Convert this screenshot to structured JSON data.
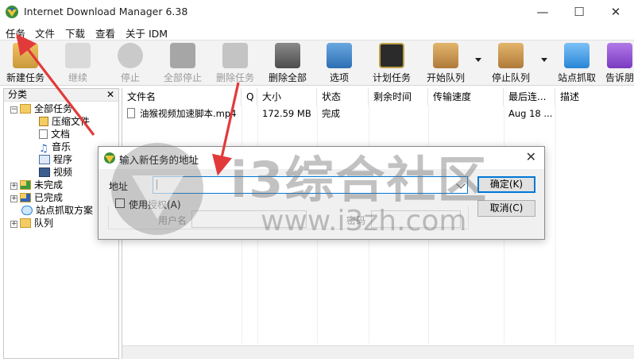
{
  "window": {
    "title": "Internet Download Manager 6.38",
    "minimize_glyph": "—",
    "maximize_glyph": "☐",
    "close_glyph": "✕"
  },
  "menu": [
    "任务",
    "文件",
    "下载",
    "查看",
    "关于 IDM"
  ],
  "toolbar": [
    {
      "label": "新建任务",
      "icon": "new-task-icon",
      "enabled": true,
      "color": "#c99a3c"
    },
    {
      "label": "继续",
      "icon": "resume-icon",
      "enabled": false,
      "color": "#8a8a8a"
    },
    {
      "label": "停止",
      "icon": "stop-icon",
      "enabled": false,
      "color": "#5a5a5a"
    },
    {
      "label": "全部停止",
      "icon": "stop-all-icon",
      "enabled": false,
      "color": "#3f3f3f"
    },
    {
      "label": "删除任务",
      "icon": "delete-task-icon",
      "enabled": false,
      "color": "#6e6e6e"
    },
    {
      "label": "删除全部",
      "icon": "delete-all-icon",
      "enabled": true,
      "color": "#4d4d4d"
    },
    {
      "label": "选项",
      "icon": "options-icon",
      "enabled": true,
      "color": "#2d6fb3"
    },
    {
      "label": "计划任务",
      "icon": "scheduler-icon",
      "enabled": true,
      "color": "#2b2b2b"
    },
    {
      "label": "开始队列",
      "icon": "start-queue-icon",
      "enabled": true,
      "color": "#b07a3a"
    },
    {
      "label": "停止队列",
      "icon": "stop-queue-icon",
      "enabled": true,
      "color": "#b07a3a"
    },
    {
      "label": "站点抓取",
      "icon": "site-grabber-icon",
      "enabled": true,
      "color": "#2a86d8"
    },
    {
      "label": "告诉朋",
      "icon": "tell-friend-icon",
      "enabled": true,
      "color": "#7a3ac0"
    }
  ],
  "categories": {
    "header": "分类",
    "close_glyph": "✕",
    "items": [
      {
        "label": "全部任务",
        "level": 0,
        "expander": "−",
        "icon": "folder-open-icon"
      },
      {
        "label": "压缩文件",
        "level": 1,
        "icon": "archive-icon"
      },
      {
        "label": "文档",
        "level": 1,
        "icon": "document-icon"
      },
      {
        "label": "音乐",
        "level": 1,
        "icon": "music-icon"
      },
      {
        "label": "程序",
        "level": 1,
        "icon": "program-icon"
      },
      {
        "label": "视频",
        "level": 1,
        "icon": "video-icon"
      },
      {
        "label": "未完成",
        "level": 0,
        "expander": "+",
        "icon": "unfinished-folder-icon"
      },
      {
        "label": "已完成",
        "level": 0,
        "expander": "+",
        "icon": "finished-folder-icon"
      },
      {
        "label": "站点抓取方案",
        "level": 0,
        "expander": "",
        "icon": "site-grab-icon"
      },
      {
        "label": "队列",
        "level": 0,
        "expander": "+",
        "icon": "queue-folder-icon"
      }
    ]
  },
  "file_list": {
    "columns": [
      "文件名",
      "Q",
      "大小",
      "状态",
      "剩余时间",
      "传输速度",
      "最后连...",
      "描述"
    ],
    "rows": [
      {
        "name": "油猴视频加速脚本.mp4",
        "q": "",
        "size": "172.59 MB",
        "status": "完成",
        "remaining": "",
        "speed": "",
        "last": "Aug 18 ...",
        "desc": ""
      }
    ]
  },
  "dialog": {
    "title": "输入新任务的地址",
    "close_glyph": "✕",
    "address_label": "地址",
    "address_value": "",
    "ok_label": "确定(K)",
    "cancel_label": "取消(C)",
    "auth_label": "使用授权(A)",
    "username_label": "用户名",
    "password_label": "密码"
  },
  "watermark": {
    "line1": "i3综合社区",
    "line2": "www.i3zh.com"
  },
  "colors": {
    "arrow": "#e23a3a",
    "accent": "#0078d7"
  }
}
